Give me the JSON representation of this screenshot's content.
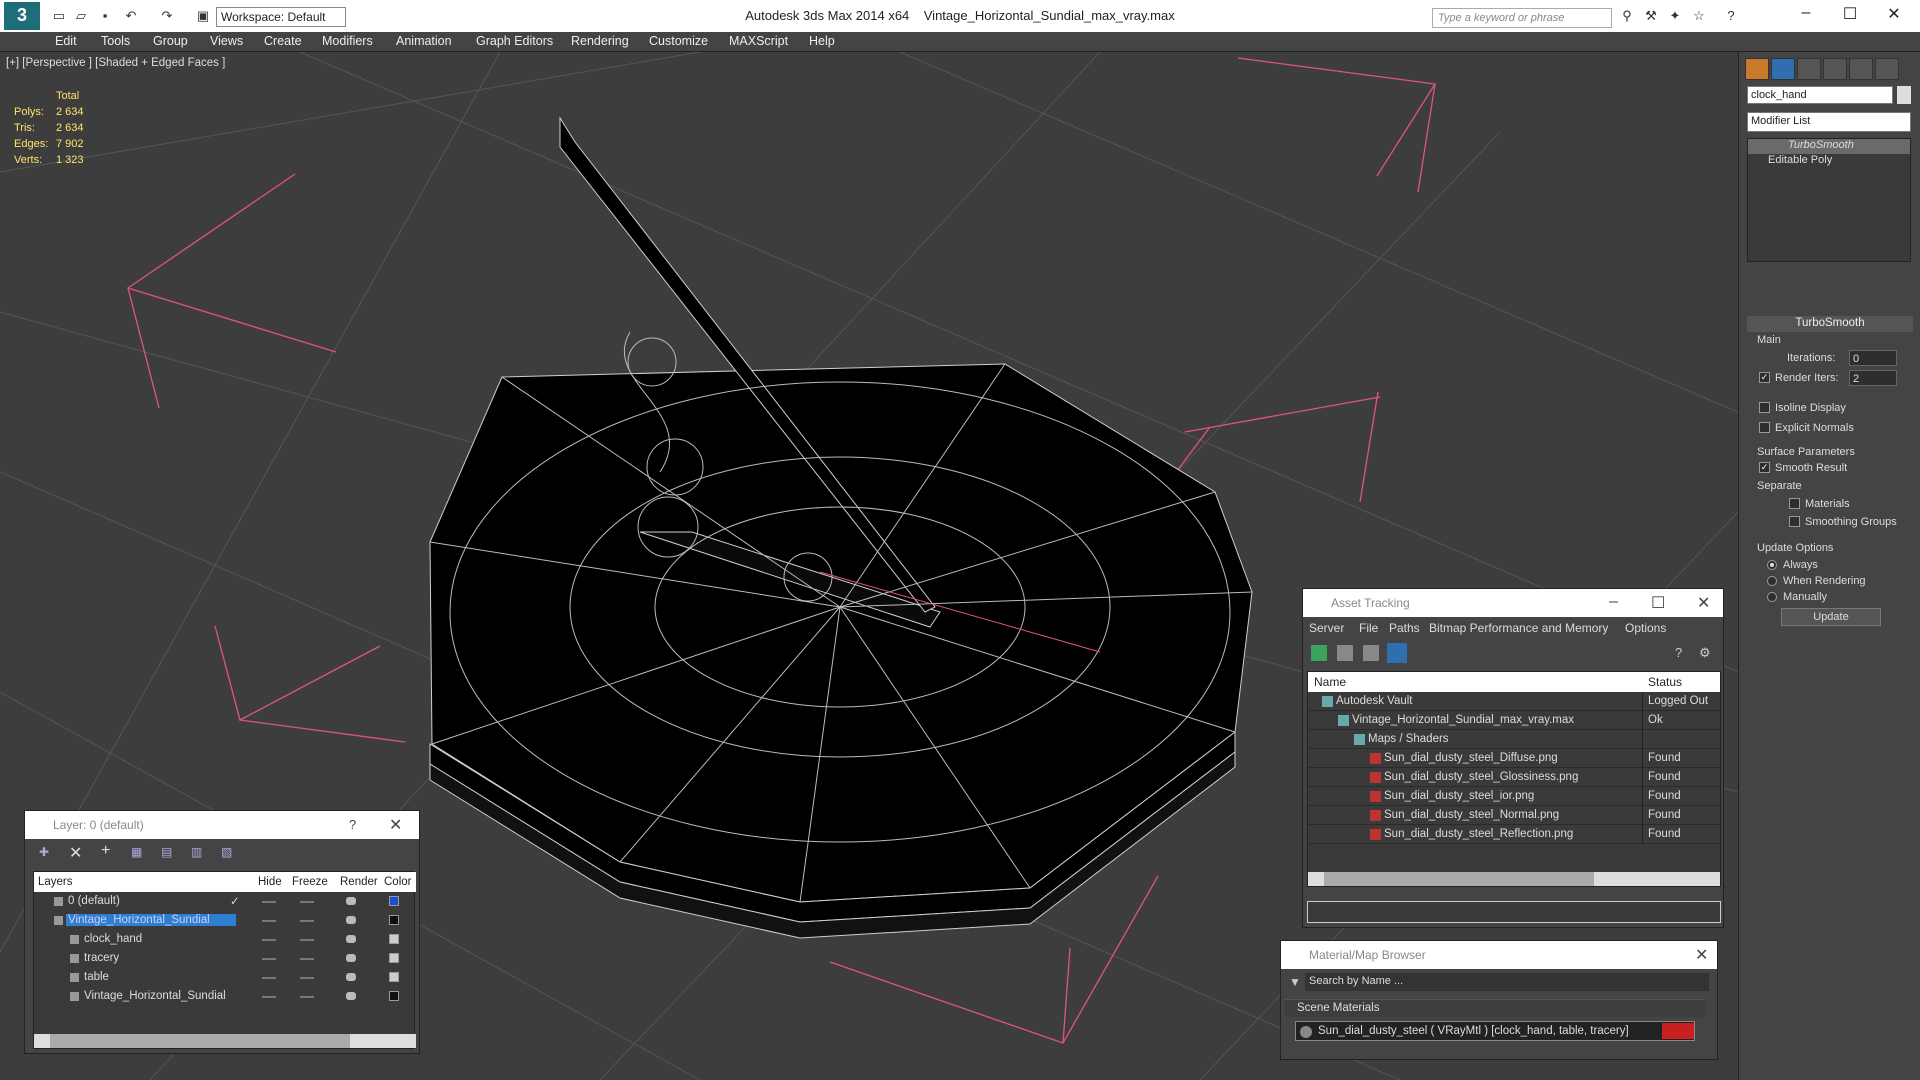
{
  "titlebar": {
    "app": "Autodesk 3ds Max  2014 x64",
    "file": "Vintage_Horizontal_Sundial_max_vray.max",
    "workspace": "Workspace: Default",
    "search_placeholder": "Type a keyword or phrase"
  },
  "menu": [
    "Edit",
    "Tools",
    "Group",
    "Views",
    "Create",
    "Modifiers",
    "Animation",
    "Graph Editors",
    "Rendering",
    "Customize",
    "MAXScript",
    "Help"
  ],
  "viewport": {
    "label": "[+] [Perspective ] [Shaded + Edged Faces ]",
    "stats_header": "Total",
    "stats": [
      {
        "label": "Polys:",
        "value": "2 634"
      },
      {
        "label": "Tris:",
        "value": "2 634"
      },
      {
        "label": "Edges:",
        "value": "7 902"
      },
      {
        "label": "Verts:",
        "value": "1 323"
      }
    ]
  },
  "cmdpanel": {
    "object_name": "clock_hand",
    "modifier_list": "Modifier List",
    "stack": [
      "TurboSmooth",
      "Editable Poly"
    ],
    "turbosmooth": {
      "title": "TurboSmooth",
      "main": "Main",
      "iterations_label": "Iterations:",
      "iterations": "0",
      "render_iters_label": "Render Iters:",
      "render_iters": "2",
      "isoline": "Isoline Display",
      "explicit": "Explicit Normals",
      "surface": "Surface Parameters",
      "smooth_result": "Smooth Result",
      "separate": "Separate",
      "materials": "Materials",
      "smoothing_groups": "Smoothing Groups",
      "update_options": "Update Options",
      "always": "Always",
      "when_rendering": "When Rendering",
      "manually": "Manually",
      "update": "Update"
    }
  },
  "asset_tracking": {
    "title": "Asset Tracking",
    "menu": [
      "Server",
      "File",
      "Paths",
      "Bitmap Performance and Memory",
      "Options"
    ],
    "col_name": "Name",
    "col_status": "Status",
    "rows": [
      {
        "name": "Autodesk Vault",
        "status": "Logged Out",
        "indent": 1
      },
      {
        "name": "Vintage_Horizontal_Sundial_max_vray.max",
        "status": "Ok",
        "indent": 2
      },
      {
        "name": "Maps / Shaders",
        "status": "",
        "indent": 3
      },
      {
        "name": "Sun_dial_dusty_steel_Diffuse.png",
        "status": "Found",
        "indent": 4
      },
      {
        "name": "Sun_dial_dusty_steel_Glossiness.png",
        "status": "Found",
        "indent": 4
      },
      {
        "name": "Sun_dial_dusty_steel_ior.png",
        "status": "Found",
        "indent": 4
      },
      {
        "name": "Sun_dial_dusty_steel_Normal.png",
        "status": "Found",
        "indent": 4
      },
      {
        "name": "Sun_dial_dusty_steel_Reflection.png",
        "status": "Found",
        "indent": 4
      }
    ]
  },
  "layers": {
    "title": "Layer: 0 (default)",
    "cols": [
      "Layers",
      "Hide",
      "Freeze",
      "Render",
      "Color"
    ],
    "rows": [
      {
        "name": "0 (default)",
        "color": "#1a4fd6",
        "level": 0
      },
      {
        "name": "Vintage_Horizontal_Sundial",
        "color": "#111111",
        "level": 0,
        "selected": true
      },
      {
        "name": "clock_hand",
        "color": "#cccccc",
        "level": 1
      },
      {
        "name": "tracery",
        "color": "#cccccc",
        "level": 1
      },
      {
        "name": "table",
        "color": "#cccccc",
        "level": 1
      },
      {
        "name": "Vintage_Horizontal_Sundial",
        "color": "#111111",
        "level": 1
      }
    ]
  },
  "material_browser": {
    "title": "Material/Map Browser",
    "search": "Search by Name ...",
    "section": "Scene Materials",
    "item": "Sun_dial_dusty_steel  ( VRayMtl ) [clock_hand, table, tracery]"
  }
}
